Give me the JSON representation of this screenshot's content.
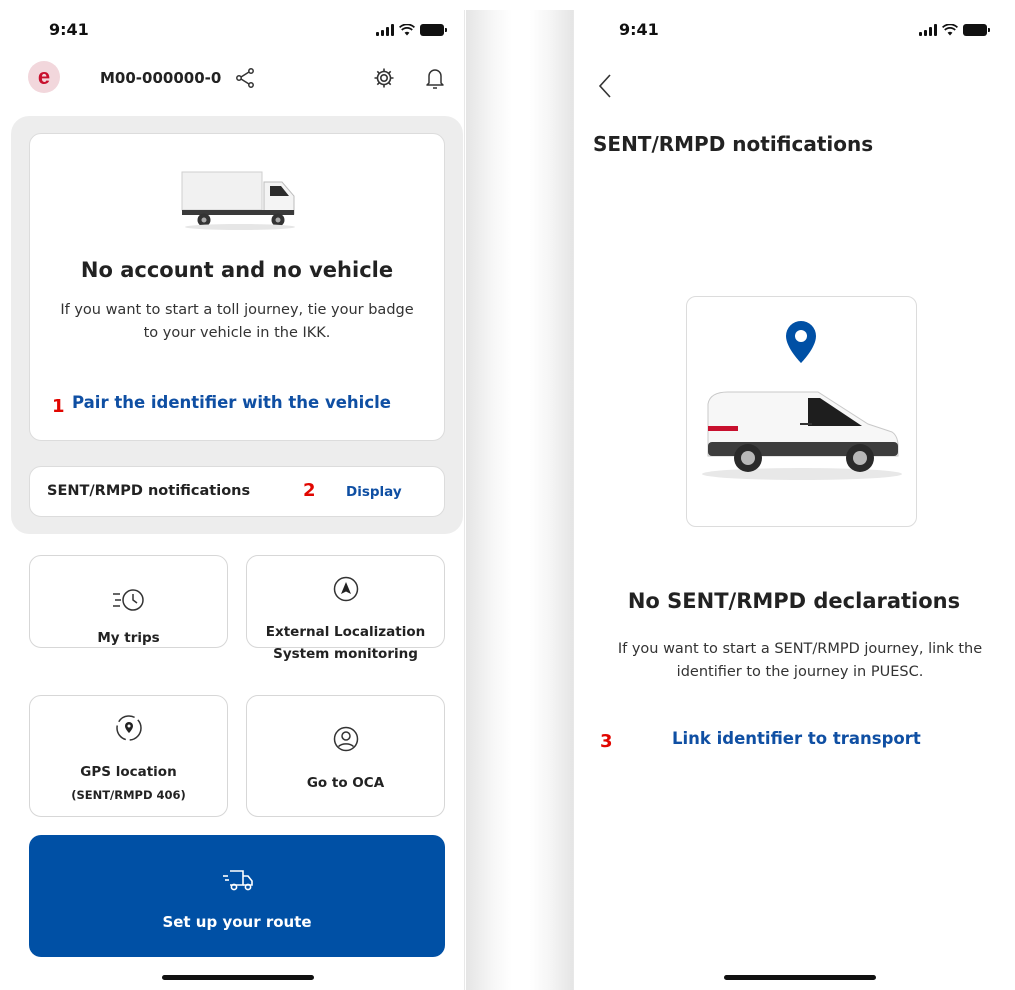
{
  "colors": {
    "accent": "#0f4fa3",
    "brand_red": "#c8102e",
    "button_blue": "#0050a5",
    "marker_red": "#e10600"
  },
  "left_screen": {
    "status_time": "9:41",
    "header": {
      "logo_letter": "e",
      "account_id": "M00-000000-0"
    },
    "vehicle_card": {
      "title": "No account and no vehicle",
      "text": "If you want to start a toll journey, tie your badge to your vehicle in the IKK.",
      "pair_link": "Pair the identifier with the vehicle",
      "marker": "1"
    },
    "notifications_row": {
      "label": "SENT/RMPD notifications",
      "marker": "2",
      "action": "Display"
    },
    "tiles": {
      "my_trips": "My trips",
      "els_line1": "External Localization",
      "els_line2": "System monitoring",
      "gps_line1": "GPS location",
      "gps_line2": "(SENT/RMPD 406)",
      "oca": "Go to OCA"
    },
    "route_button": "Set up your route"
  },
  "right_screen": {
    "status_time": "9:41",
    "title": "SENT/RMPD notifications",
    "empty_title": "No SENT/RMPD declarations",
    "empty_text": "If you want to start a SENT/RMPD journey, link the identifier to the journey in PUESC.",
    "marker": "3",
    "link": "Link identifier to transport"
  },
  "icons": [
    "share-icon",
    "gear-icon",
    "bell-icon",
    "clock-icon",
    "navigation-arrow-icon",
    "location-pin-icon",
    "user-circle-icon",
    "delivery-truck-icon",
    "chevron-left-icon",
    "signal-icon",
    "wifi-icon",
    "battery-icon"
  ]
}
